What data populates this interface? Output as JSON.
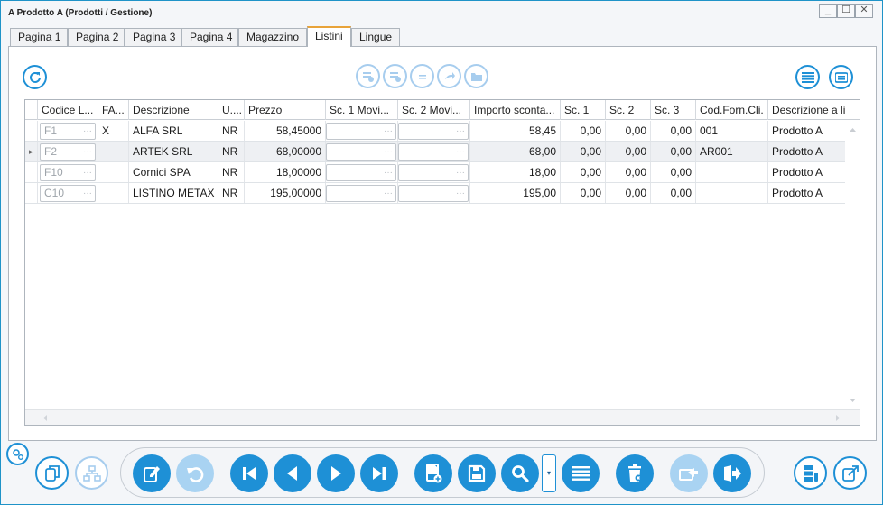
{
  "window": {
    "title": "A Prodotto A (Prodotti / Gestione)",
    "controls": {
      "minimize": "_",
      "maximize": "☐",
      "close": "✕"
    }
  },
  "tabs": [
    "Pagina 1",
    "Pagina 2",
    "Pagina 3",
    "Pagina 4",
    "Magazzino",
    "Listini",
    "Lingue"
  ],
  "active_tab": "Listini",
  "grid": {
    "columns": [
      "",
      "Codice L...",
      "FA...",
      "Descrizione",
      "U....",
      "Prezzo",
      "Sc. 1 Movi...",
      "Sc. 2 Movi...",
      "Importo sconta...",
      "Sc. 1",
      "Sc. 2",
      "Sc. 3",
      "Cod.Forn.Cli.",
      "Descrizione a li"
    ],
    "rows": [
      {
        "codice": "F1",
        "fa": "X",
        "descrizione": "ALFA SRL",
        "um": "NR",
        "prezzo": "58,45000",
        "importo": "58,45",
        "sc1": "0,00",
        "sc2": "0,00",
        "sc3": "0,00",
        "codforn": "001",
        "desc_li": "Prodotto A"
      },
      {
        "codice": "F2",
        "fa": "",
        "descrizione": "ARTEK SRL",
        "um": "NR",
        "prezzo": "68,00000",
        "importo": "68,00",
        "sc1": "0,00",
        "sc2": "0,00",
        "sc3": "0,00",
        "codforn": "AR001",
        "desc_li": "Prodotto A"
      },
      {
        "codice": "F10",
        "fa": "",
        "descrizione": "Cornici SPA",
        "um": "NR",
        "prezzo": "18,00000",
        "importo": "18,00",
        "sc1": "0,00",
        "sc2": "0,00",
        "sc3": "0,00",
        "codforn": "",
        "desc_li": "Prodotto A"
      },
      {
        "codice": "C10",
        "fa": "",
        "descrizione": "LISTINO METAX",
        "um": "NR",
        "prezzo": "195,00000",
        "importo": "195,00",
        "sc1": "0,00",
        "sc2": "0,00",
        "sc3": "0,00",
        "codforn": "",
        "desc_li": "Prodotto A"
      }
    ],
    "selected_row": 1,
    "row_indicator": "▸",
    "cell_dots": "···"
  },
  "icons": {
    "refresh": "refresh-icon",
    "list_view": "list-view-icon",
    "card_view": "card-view-icon",
    "settings": "gears-icon",
    "bottom_left": [
      "copy-icon",
      "hierarchy-icon"
    ],
    "navigation": [
      "edit-icon",
      "undo-icon",
      "first-record-icon",
      "previous-record-icon",
      "next-record-icon",
      "last-record-icon",
      "new-record-icon",
      "save-icon",
      "search-icon",
      "search-options-dropdown",
      "list-icon",
      "delete-icon",
      "export-icon",
      "exit-icon"
    ],
    "bottom_right": [
      "database-icon",
      "open-external-icon"
    ]
  },
  "colors": {
    "accent": "#1e90d6",
    "accent_faded": "#a9d3f2",
    "active_tab_border": "#e8a33a",
    "window_border": "#1f93c8"
  }
}
